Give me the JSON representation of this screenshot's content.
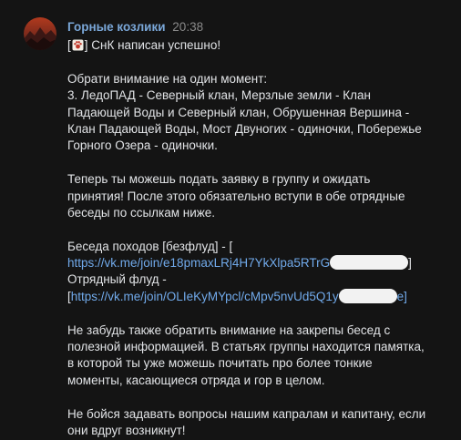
{
  "message": {
    "author": "Горные козлики",
    "time": "20:38",
    "emoji_icon": "paw-icon",
    "line1_prefix": "[",
    "line1_text": "] СнК написан успешно!",
    "notice_title": "Обрати внимание на один момент:",
    "notice_lines": [
      "3. ЛедоПАД - Северный клан, Мерзлые земли - Клан",
      "Падающей Воды и Северный клан, Обрушенная Вершина -",
      "Клан Падающей Воды, Мост Двуногих - одиночки, Побережье",
      "Горного Озера - одиночки."
    ],
    "apply_lines": [
      "Теперь ты можешь подать заявку в группу и ожидать",
      "принятия! После этого обязательно вступи в обе отрядные",
      "беседы по ссылкам ниже."
    ],
    "chat1_label": "Беседа походов [безфлуд] - [",
    "chat1_link": "https://vk.me/join/e18pmaxLRj4H7YkXlpa5RTrG",
    "chat1_close": "]",
    "chat2_label": "Отрядный флуд -",
    "chat2_open": "[",
    "chat2_link": "https://vk.me/join/OLIeKyMYpcl/cMpv5nvUd5Q1y",
    "chat2_tail": "e]",
    "pinned_lines": [
      "Не забудь также обратить внимание на закрепы бесед с",
      "полезной информацией. В статьях группы находится памятка,",
      "в которой ты уже можешь почитать про более тонкие",
      "моменты, касающиеся отряда и гор в целом."
    ],
    "questions_lines": [
      "Не бойся задавать вопросы нашим капралам и капитану, если",
      "они вдруг возникнут!"
    ]
  }
}
